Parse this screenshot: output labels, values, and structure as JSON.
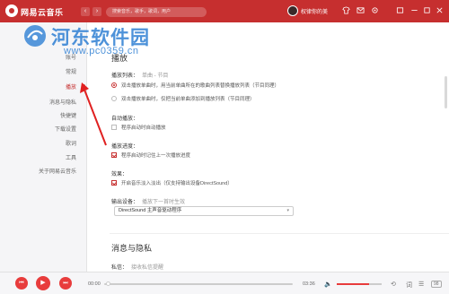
{
  "titlebar": {
    "app_title": "网易云音乐",
    "search_placeholder": "搜索音乐，歌手，歌词，用户",
    "username": "权律你的美",
    "back_icon": "‹",
    "forward_icon": "›"
  },
  "sidebar": {
    "items": [
      {
        "label": "账号"
      },
      {
        "label": "常规"
      },
      {
        "label": "播放"
      },
      {
        "label": "消息与隐私"
      },
      {
        "label": "快捷键"
      },
      {
        "label": "下载设置"
      },
      {
        "label": "歌词"
      },
      {
        "label": "工具"
      },
      {
        "label": "关于网易云音乐"
      }
    ],
    "active_index": 2
  },
  "content": {
    "section_title": "播放",
    "playlist_label": "播放列表：",
    "playlist_hint": "单曲 - 节目",
    "playlist_options": [
      {
        "label": "双击播放单曲时，用当前单曲所在的歌曲列表替换播放列表（节目同理）",
        "selected": true
      },
      {
        "label": "双击播放单曲时，仅把当前单曲添加到播放列表（节目同理）",
        "selected": false
      }
    ],
    "autoplay_label": "自动播放：",
    "autoplay_option": "程序启动时自动播放",
    "progress_label": "播放进度：",
    "progress_option": "程序启动时记住上一次播放进度",
    "effect_label": "效果：",
    "effect_option": "开启音乐淡入淡出（仅支持输出设备DirectSound）",
    "output_label": "输出设备：",
    "output_hint": "播放下一首时生效",
    "output_selected": "DirectSound 主声音驱动程序",
    "section2_title": "消息与隐私",
    "private_msg_label": "私信：",
    "private_msg_value": "接收私信提醒"
  },
  "watermark": {
    "title": "河东软件园",
    "url": "www.pc0359.cn"
  },
  "player": {
    "time_current": "00:00",
    "time_total": "03:36",
    "volume_level": 0.72,
    "count_badge": "98"
  },
  "colors": {
    "brand_red": "#c62f2f",
    "player_red": "#e83c3c",
    "watermark_blue": "#2e7fd3"
  }
}
